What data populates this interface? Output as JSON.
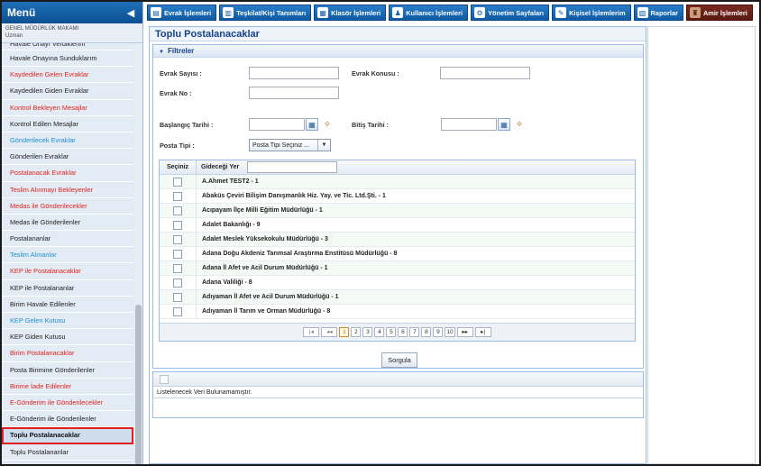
{
  "sidebar": {
    "title": "Menü",
    "user_unit": "GENEL MÜDÜRLÜK MAKAMI",
    "user_role": "Uzman",
    "items": [
      {
        "label": "Havale Onayı Verdiklerim",
        "style": "cut"
      },
      {
        "label": "Havale Onayına Sunduklarım",
        "style": ""
      },
      {
        "label": "Kaydedilen Gelen Evraklar",
        "style": "red"
      },
      {
        "label": "Kaydedilen Giden Evraklar",
        "style": ""
      },
      {
        "label": "Kontrol Bekleyen Mesajlar",
        "style": "red"
      },
      {
        "label": "Kontrol Edilen Mesajlar",
        "style": ""
      },
      {
        "label": "Gönderilecek Evraklar",
        "style": "blue"
      },
      {
        "label": "Gönderilen Evraklar",
        "style": ""
      },
      {
        "label": "Postalanacak Evraklar",
        "style": "red"
      },
      {
        "label": "Teslim Alınmayı Bekleyenler",
        "style": "red"
      },
      {
        "label": "Medas ile Gönderilecekler",
        "style": "red"
      },
      {
        "label": "Medas ile Gönderilenler",
        "style": ""
      },
      {
        "label": "Postalananlar",
        "style": ""
      },
      {
        "label": "Teslim Alınanlar",
        "style": "blue"
      },
      {
        "label": "KEP ile Postalanacaklar",
        "style": "red"
      },
      {
        "label": "KEP ile Postalananlar",
        "style": ""
      },
      {
        "label": "Birim Havale Edilenler",
        "style": ""
      },
      {
        "label": "KEP Gelen Kutusu",
        "style": "blue"
      },
      {
        "label": "KEP Giden Kutusu",
        "style": ""
      },
      {
        "label": "Birim Postalanacaklar",
        "style": "red"
      },
      {
        "label": "Posta Birimine Gönderilenler",
        "style": ""
      },
      {
        "label": "Birime İade Edilenler",
        "style": "red"
      },
      {
        "label": "E-Gönderim ile Gönderilecekler",
        "style": "red"
      },
      {
        "label": "E-Gönderim ile Gönderilenler",
        "style": ""
      },
      {
        "label": "Toplu Postalanacaklar",
        "style": "active"
      },
      {
        "label": "Toplu Postalananlar",
        "style": ""
      }
    ]
  },
  "topnav": [
    {
      "label": "Evrak İşlemleri",
      "icon": "document-icon",
      "glyph": "▤"
    },
    {
      "label": "Teşkilat/Kişi Tanımları",
      "icon": "organization-icon",
      "glyph": "▥"
    },
    {
      "label": "Klasör İşlemleri",
      "icon": "folder-icon",
      "glyph": "▦"
    },
    {
      "label": "Kullanıcı İşlemleri",
      "icon": "user-icon",
      "glyph": "♟"
    },
    {
      "label": "Yönetim Sayfaları",
      "icon": "admin-icon",
      "glyph": "⚙"
    },
    {
      "label": "Kişisel İşlemlerim",
      "icon": "personal-icon",
      "glyph": "✎"
    },
    {
      "label": "Raporlar",
      "icon": "report-icon",
      "glyph": "▧"
    },
    {
      "label": "Amir İşlemleri",
      "icon": "manager-icon",
      "glyph": "♜"
    }
  ],
  "page": {
    "title": "Toplu Postalanacaklar",
    "filters_title": "Filtreler",
    "labels": {
      "evrak_sayisi": "Evrak Sayısı :",
      "evrak_konusu": "Evrak Konusu :",
      "evrak_no": "Evrak No :",
      "baslangic_tarihi": "Başlangıç Tarihi :",
      "bitis_tarihi": "Bitiş Tarihi :",
      "posta_tipi": "Posta Tipi :"
    },
    "values": {
      "evrak_sayisi": "",
      "evrak_konusu": "",
      "evrak_no": "",
      "baslangic_tarihi": "",
      "bitis_tarihi": ""
    },
    "posta_tipi_selected": "Posta Tipi Seçiniz ...",
    "grid": {
      "col_select": "Seçiniz",
      "col_destination": "Gideceği Yer",
      "filter_value": "",
      "rows": [
        "A.Ahmet TEST2 - 1",
        "Abaküs Çeviri Bilişim Danışmanlık Hiz. Yay. ve Tic. Ltd.Şti. - 1",
        "Acıpayam İlçe Milli Eğitim Müdürlüğü - 1",
        "Adalet Bakanlığı - 9",
        "Adalet Meslek Yüksekokulu Müdürlüğü - 3",
        "Adana Doğu Akdeniz Tarımsal Araştırma Enstitüsü Müdürlüğü - 8",
        "Adana İl Afet ve Acil Durum Müdürlüğü - 1",
        "Adana Valiliği - 8",
        "Adıyaman İl Afet ve Acil Durum Müdürlüğü - 1",
        "Adıyaman İl Tarım ve Orman Müdürlüğü - 8"
      ],
      "pager": {
        "first": "|◂",
        "prev": "◂◂",
        "pages": [
          "1",
          "2",
          "3",
          "4",
          "5",
          "6",
          "7",
          "8",
          "9",
          "10"
        ],
        "current": "1",
        "next": "▸▸",
        "last": "▸|"
      }
    },
    "query_button": "Sorgula",
    "results_empty": "Listelenecek Veri Bulunamamıştır."
  }
}
